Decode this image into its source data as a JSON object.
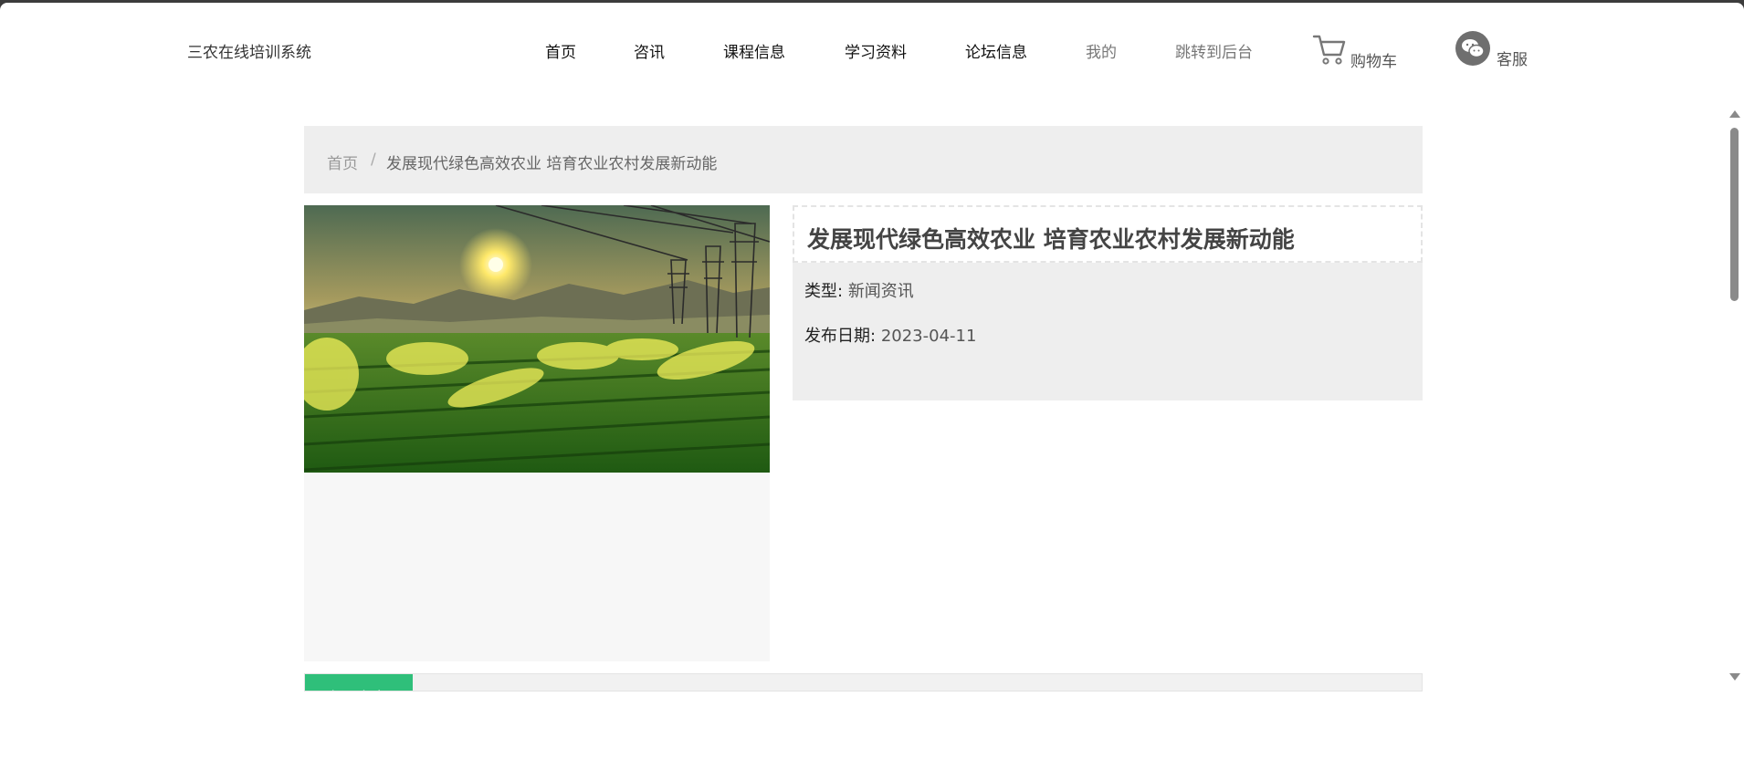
{
  "site": {
    "title": "三农在线培训系统"
  },
  "nav": {
    "items": [
      {
        "label": "首页"
      },
      {
        "label": "咨讯"
      },
      {
        "label": "课程信息"
      },
      {
        "label": "学习资料"
      },
      {
        "label": "论坛信息"
      },
      {
        "label": "我的"
      },
      {
        "label": "跳转到后台"
      }
    ],
    "cart_label": "购物车",
    "service_label": "客服"
  },
  "breadcrumb": {
    "home": "首页",
    "separator": "/",
    "current": "发展现代绿色高效农业 培育农业农村发展新动能"
  },
  "article": {
    "title": "发展现代绿色高效农业 培育农业农村发展新动能",
    "type_label": "类型:",
    "type_value": "新闻资讯",
    "date_label": "发布日期:",
    "date_value": "2023-04-11",
    "image_icon": "farmland-sunset-photo"
  },
  "tabs": {
    "active_label": "资讯内容"
  },
  "colors": {
    "accent": "#2fbf7a",
    "panel_bg": "#eeeeee"
  }
}
